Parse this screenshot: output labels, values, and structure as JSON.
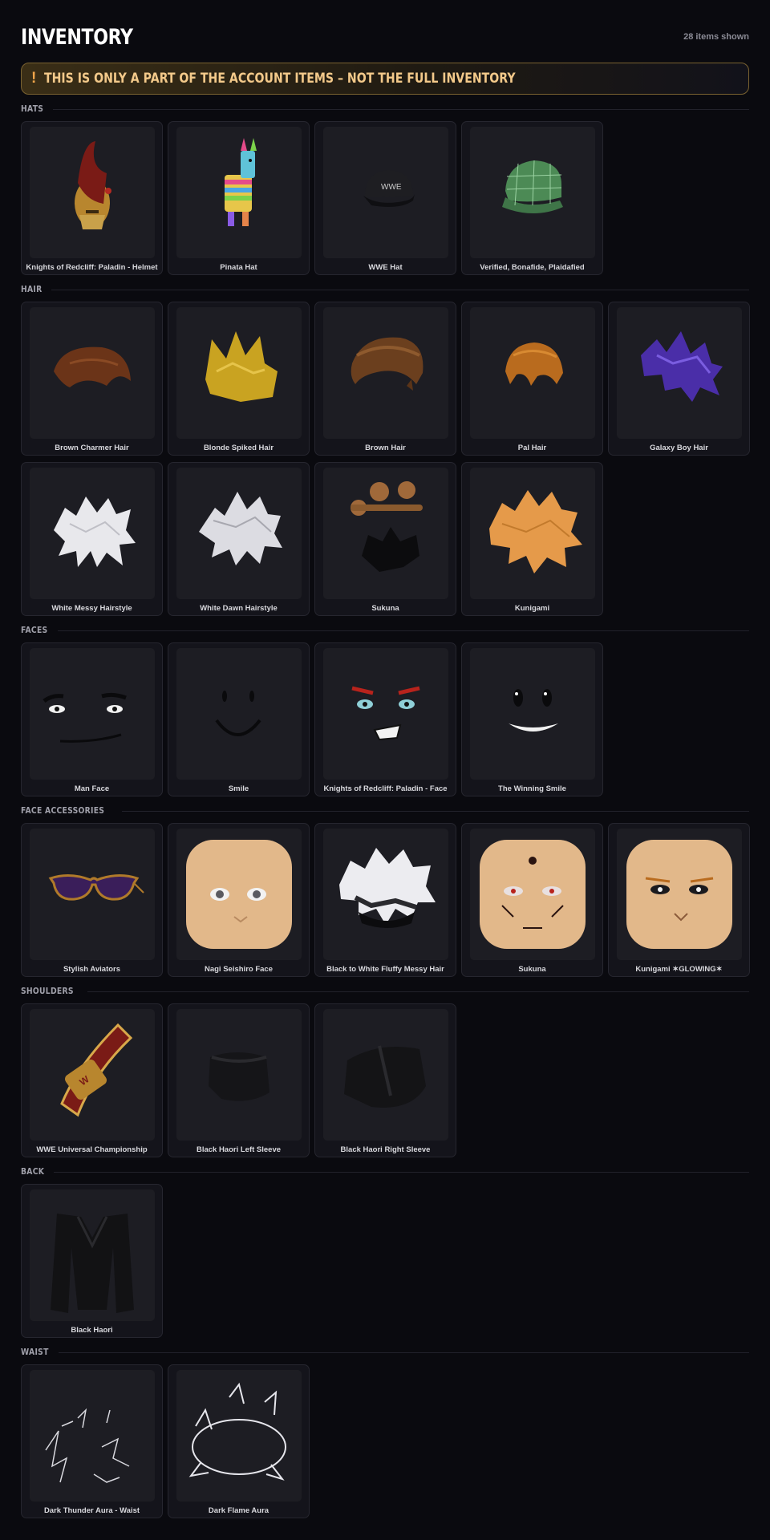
{
  "header": {
    "title": "INVENTORY",
    "count_text": "28 items shown"
  },
  "banner": {
    "icon": "exclamation-icon",
    "icon_glyph": "!",
    "text": "THIS IS ONLY A PART OF THE ACCOUNT ITEMS – NOT THE FULL INVENTORY"
  },
  "sections": [
    {
      "label": "HATS",
      "items": [
        {
          "name": "Knights of Redcliff: Paladin - Helmet",
          "icon": "helmet-icon"
        },
        {
          "name": "Pinata Hat",
          "icon": "pinata-icon"
        },
        {
          "name": "WWE Hat",
          "icon": "cap-icon"
        },
        {
          "name": "Verified, Bonafide, Plaidafied",
          "icon": "plaid-cap-icon"
        }
      ]
    },
    {
      "label": "HAIR",
      "items": [
        {
          "name": "Brown Charmer Hair",
          "icon": "hair-icon"
        },
        {
          "name": "Blonde Spiked Hair",
          "icon": "hair-icon"
        },
        {
          "name": "Brown Hair",
          "icon": "hair-icon"
        },
        {
          "name": "Pal Hair",
          "icon": "hair-icon"
        },
        {
          "name": "Galaxy Boy Hair",
          "icon": "hair-icon"
        },
        {
          "name": "White Messy Hairstyle",
          "icon": "hair-icon"
        },
        {
          "name": "White Dawn Hairstyle",
          "icon": "hair-icon"
        },
        {
          "name": "Sukuna",
          "icon": "hair-icon"
        },
        {
          "name": "Kunigami",
          "icon": "hair-icon"
        }
      ]
    },
    {
      "label": "FACES",
      "items": [
        {
          "name": "Man Face",
          "icon": "face-icon"
        },
        {
          "name": "Smile",
          "icon": "face-icon"
        },
        {
          "name": "Knights of Redcliff: Paladin - Face",
          "icon": "face-icon"
        },
        {
          "name": "The Winning Smile",
          "icon": "face-icon"
        }
      ]
    },
    {
      "label": "FACE ACCESSORIES",
      "items": [
        {
          "name": "Stylish Aviators",
          "icon": "sunglasses-icon"
        },
        {
          "name": "Nagi Seishiro Face",
          "icon": "head-icon"
        },
        {
          "name": "Black to White Fluffy Messy Hair",
          "icon": "hair-icon"
        },
        {
          "name": "Sukuna",
          "icon": "head-icon"
        },
        {
          "name": "Kunigami ✶GLOWING✶",
          "icon": "head-icon"
        }
      ]
    },
    {
      "label": "SHOULDERS",
      "items": [
        {
          "name": "WWE Universal Championship",
          "icon": "belt-icon"
        },
        {
          "name": "Black Haori Left Sleeve",
          "icon": "sleeve-icon"
        },
        {
          "name": "Black Haori Right Sleeve",
          "icon": "sleeve-icon"
        }
      ]
    },
    {
      "label": "BACK",
      "items": [
        {
          "name": "Black Haori",
          "icon": "haori-icon"
        }
      ]
    },
    {
      "label": "WAIST",
      "items": [
        {
          "name": "Dark Thunder Aura - Waist",
          "icon": "aura-icon"
        },
        {
          "name": "Dark Flame Aura",
          "icon": "aura-icon"
        }
      ]
    }
  ],
  "colors": {
    "background": "#0a0a0f",
    "card": "#14141b",
    "thumb": "#1d1d23",
    "banner_border": "#7a6230",
    "banner_text": "#f3c98a",
    "banner_icon": "#f0a54a"
  }
}
